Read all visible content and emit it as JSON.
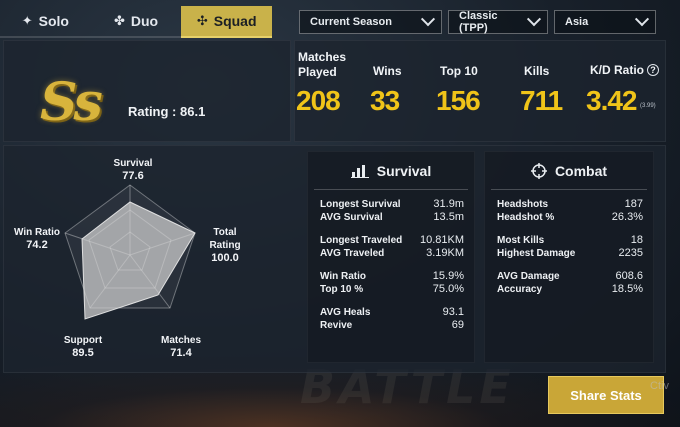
{
  "tabs": [
    {
      "label": "Solo",
      "icon": "person-icon",
      "active": false
    },
    {
      "label": "Duo",
      "icon": "two-people-icon",
      "active": false
    },
    {
      "label": "Squad",
      "icon": "squad-icon",
      "active": true
    }
  ],
  "filters": {
    "season": "Current Season",
    "mode": "Classic (TPP)",
    "region": "Asia"
  },
  "rank": {
    "badge": "Ss",
    "rating_label": "Rating :",
    "rating_value": "86.1"
  },
  "stats": {
    "matches_label_1": "Matches",
    "matches_label_2": "Played",
    "matches": "208",
    "wins_label": "Wins",
    "wins": "33",
    "top10_label": "Top 10",
    "top10": "156",
    "kills_label": "Kills",
    "kills": "711",
    "kd_label": "K/D Ratio",
    "kd": "3.42",
    "kd_sub": "(3.99)"
  },
  "radar": {
    "survival_label": "Survival",
    "survival": "77.6",
    "total_label": "Total Rating",
    "total": "100.0",
    "matches_label": "Matches",
    "matches": "71.4",
    "support_label": "Support",
    "support": "89.5",
    "winratio_label": "Win Ratio",
    "winratio": "74.2"
  },
  "survival": {
    "title": "Survival",
    "groups": [
      [
        {
          "k": "Longest Survival",
          "v": "31.9m"
        },
        {
          "k": "AVG Survival",
          "v": "13.5m"
        }
      ],
      [
        {
          "k": "Longest Traveled",
          "v": "10.81KM"
        },
        {
          "k": "AVG Traveled",
          "v": "3.19KM"
        }
      ],
      [
        {
          "k": "Win Ratio",
          "v": "15.9%"
        },
        {
          "k": "Top 10 %",
          "v": "75.0%"
        }
      ],
      [
        {
          "k": "AVG Heals",
          "v": "93.1"
        },
        {
          "k": "Revive",
          "v": "69"
        }
      ]
    ]
  },
  "combat": {
    "title": "Combat",
    "groups": [
      [
        {
          "k": "Headshots",
          "v": "187"
        },
        {
          "k": "Headshot %",
          "v": "26.3%"
        }
      ],
      [
        {
          "k": "Most Kills",
          "v": "18"
        },
        {
          "k": "Highest Damage",
          "v": "2235"
        }
      ],
      [
        {
          "k": "AVG Damage",
          "v": "608.6"
        },
        {
          "k": "Accuracy",
          "v": "18.5%"
        }
      ]
    ]
  },
  "share_label": "Share Stats",
  "edge_text": "Ctiv",
  "bg_text": "BATTLE"
}
